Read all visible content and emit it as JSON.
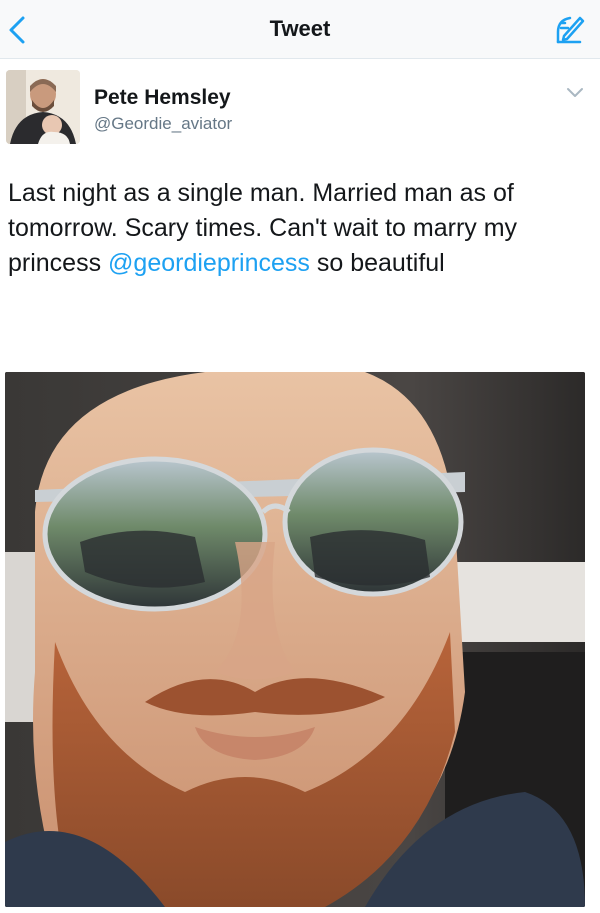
{
  "nav": {
    "title": "Tweet",
    "back_icon": "chevron-left-icon",
    "compose_icon": "compose-icon",
    "accent": "#1da1f2"
  },
  "author": {
    "name": "Pete Hemsley",
    "handle": "@Geordie_aviator",
    "menu_icon": "chevron-down-icon"
  },
  "tweet": {
    "text_part1": "Last night as a single man. Married man as of tomorrow. Scary times. Can't wait to marry my princess ",
    "mention": "@geordieprincess",
    "text_part2": " so beautiful"
  },
  "colors": {
    "text": "#14171a",
    "secondary": "#657786",
    "link": "#1da1f2",
    "divider": "#e1e8ed"
  }
}
